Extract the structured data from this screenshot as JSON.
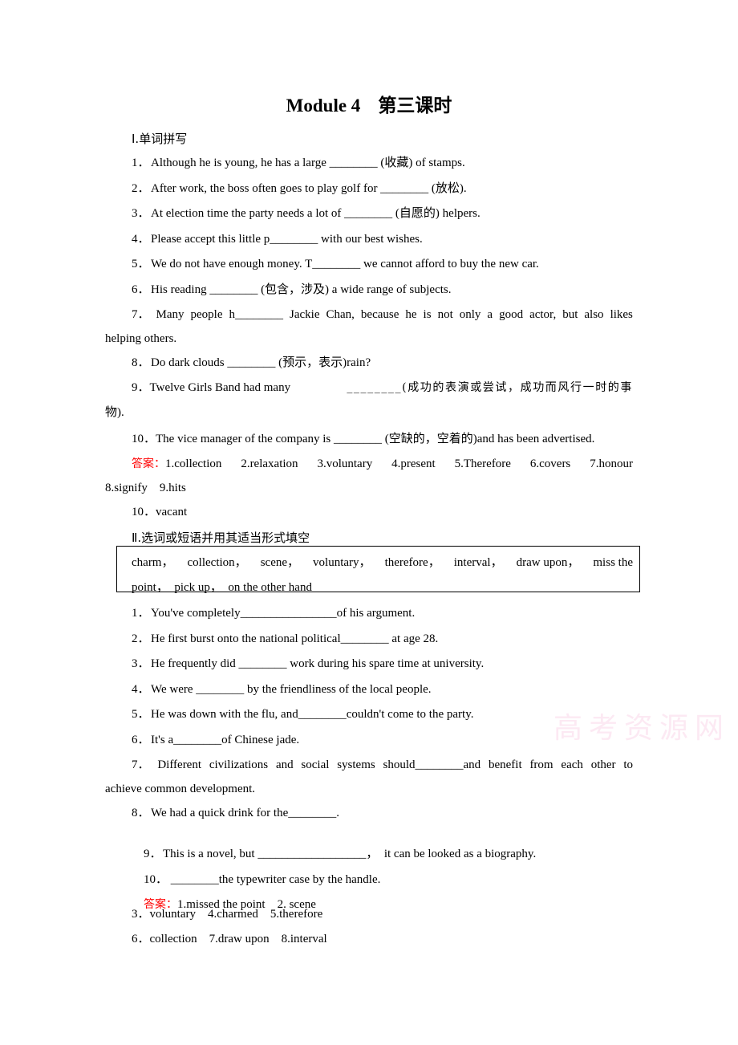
{
  "title": {
    "en": "Module 4",
    "cn": "第三课时"
  },
  "section1": {
    "heading": "Ⅰ.单词拼写",
    "items": [
      {
        "num": "1．",
        "text": "Although he is young, he has a large ________ (收藏) of stamps."
      },
      {
        "num": "2．",
        "text": "After work, the boss often goes to play golf for ________ (放松)."
      },
      {
        "num": "3．",
        "text": "At election time the party needs a lot of ________ (自愿的) helpers."
      },
      {
        "num": "4．",
        "text": "Please accept this little p________ with our best wishes."
      },
      {
        "num": "5．",
        "text": "We do not have enough money. T________ we cannot afford to buy the new car."
      },
      {
        "num": "6．",
        "text": "His reading ________ (包含，涉及) a wide range of subjects."
      },
      {
        "num": "7．",
        "line1": [
          "Many",
          "people",
          "h________",
          "Jackie",
          "Chan,",
          "because",
          "he",
          "is",
          "not",
          "only",
          "a",
          "good",
          "actor,",
          "but",
          "also",
          "likes"
        ],
        "line2": "helping others."
      },
      {
        "num": "8．",
        "text": "Do dark clouds ________ (预示，表示)rain?"
      },
      {
        "num": "9．",
        "line1": [
          "Twelve Girls Band had many",
          "________(成功的表演或尝试，成功而风行一时的事"
        ],
        "line2": "物)."
      },
      {
        "num": "10．",
        "text": "The vice manager of the company is ________ (空缺的，空着的)and has been advertised."
      }
    ],
    "answer": {
      "label": "答案：",
      "line1": [
        "1.collection",
        "2.relaxation",
        "3.voluntary",
        "4.present",
        "5.Therefore",
        "6.covers",
        "7.honour"
      ],
      "line2": "8.signify    9.hits",
      "line3": "10．vacant"
    }
  },
  "section2": {
    "heading": "Ⅱ.选词或短语并用其适当形式填空",
    "word_box": {
      "line1": [
        "charm，",
        "collection，",
        "scene，",
        "voluntary，",
        "therefore，",
        "interval，",
        "draw upon，",
        "miss the"
      ],
      "line2": "point，  pick up，  on the other hand"
    },
    "items": [
      {
        "num": "1．",
        "text": "You've completely________________of his argument."
      },
      {
        "num": "2．",
        "text": "He first burst onto the national political________ at age 28."
      },
      {
        "num": "3．",
        "text": "He frequently did ________ work during his spare time at university."
      },
      {
        "num": "4．",
        "text": "We were ________ by the friendliness of the local people."
      },
      {
        "num": "5．",
        "text": "He was down with the flu, and________couldn't come to the party."
      },
      {
        "num": "6．",
        "text": "It's a________of Chinese jade."
      },
      {
        "num": "7．",
        "line1": [
          "Different",
          "civilizations",
          "and",
          "social",
          "systems",
          "should________and",
          "benefit",
          "from",
          "each",
          "other",
          "to"
        ],
        "line2": "achieve common development."
      },
      {
        "num": "8．",
        "text": "We had a quick drink for the________."
      },
      {
        "num": "9．",
        "text": "This is a novel, but __________________，  it can be looked as a biography."
      },
      {
        "num": "10．",
        "text": " ________the typewriter case by the handle."
      }
    ],
    "answer": {
      "label": "答案：",
      "line1": "1.missed the point    2. scene",
      "line2": "3．voluntary    4.charmed    5.therefore",
      "line3": "6．collection    7.draw upon    8.interval"
    }
  },
  "watermark": "高考资源网"
}
